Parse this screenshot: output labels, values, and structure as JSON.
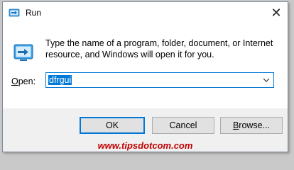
{
  "window": {
    "title": "Run",
    "close_glyph": "✕"
  },
  "dialog": {
    "description": "Type the name of a program, folder, document, or Internet resource, and Windows will open it for you.",
    "open_label_mnemonic": "O",
    "open_label_rest": "pen:",
    "open_value": "dfrgui"
  },
  "buttons": {
    "ok": "OK",
    "cancel": "Cancel",
    "browse_mnemonic": "B",
    "browse_rest": "rowse..."
  },
  "watermark": "www.tipsdotcom.com",
  "colors": {
    "accent": "#0078d7",
    "watermark": "#c00000",
    "footer": "#f0f0f0"
  },
  "icons": [
    "run-icon",
    "close-icon",
    "chevron-down-icon"
  ]
}
